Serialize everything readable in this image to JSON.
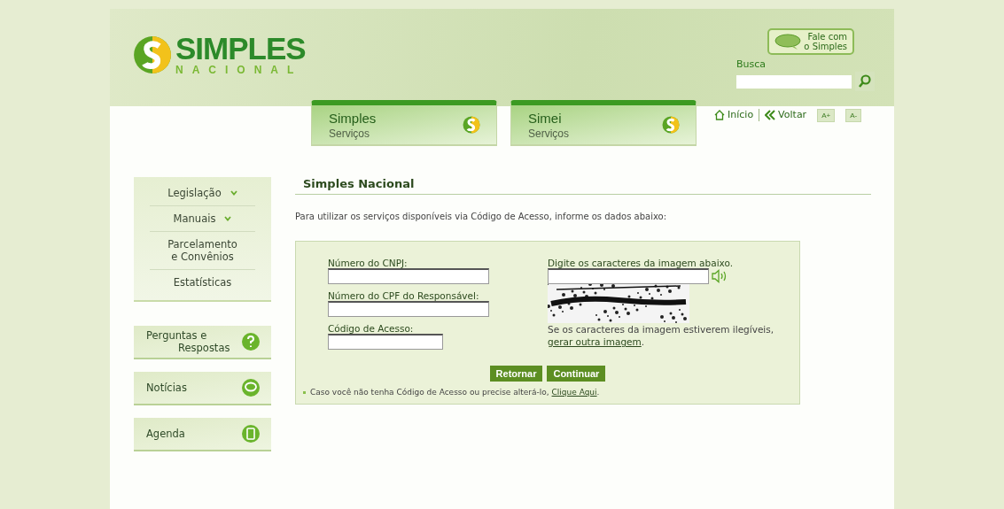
{
  "logo": {
    "name": "SIMPLES",
    "subtitle": "NACIONAL"
  },
  "contact_button": {
    "lines": [
      "Fale com",
      "o Simples"
    ]
  },
  "search": {
    "label": "Busca"
  },
  "service_tabs": [
    {
      "title": "Simples",
      "subtitle": "Serviços"
    },
    {
      "title": "Simei",
      "subtitle": "Serviços"
    }
  ],
  "top_links": [
    {
      "label": "Início",
      "kind": "home"
    },
    {
      "label": "Voltar",
      "kind": "back"
    }
  ],
  "font_buttons": [
    "A+",
    "A-"
  ],
  "sidebar": {
    "menu": [
      {
        "label": "Legislação",
        "expandable": true
      },
      {
        "label": "Manuais",
        "expandable": true
      },
      {
        "label": "Parcelamento e Convênios",
        "expandable": false
      },
      {
        "label": "Estatísticas",
        "expandable": false
      }
    ],
    "shortcuts": [
      {
        "lines": [
          "Perguntas e",
          "Respostas"
        ],
        "kind": "question"
      },
      {
        "lines": [
          "Notícias"
        ],
        "kind": "chat"
      },
      {
        "lines": [
          "Agenda"
        ],
        "kind": "book"
      }
    ]
  },
  "content": {
    "title": "Simples Nacional",
    "intro": "Para utilizar os serviços disponíveis via Código de Acesso, informe os dados abaixo:",
    "fields": [
      {
        "label": "Número do CNPJ:",
        "kind": "long"
      },
      {
        "label": "Número do CPF do Responsável:",
        "kind": "long"
      },
      {
        "label": "Código de Acesso:",
        "kind": "short"
      }
    ],
    "captcha": {
      "label": "Digite os caracteres da imagem abaixo.",
      "hint": "Se os caracteres da imagem estiverem ilegíveis,",
      "link": "gerar outra imagem",
      "suffix": "."
    },
    "buttons": [
      "Retornar",
      "Continuar"
    ],
    "note": {
      "text": "Caso você não tenha Código de Acesso ou precise alterá-lo,",
      "link": "Clique Aqui",
      "suffix": "."
    }
  }
}
